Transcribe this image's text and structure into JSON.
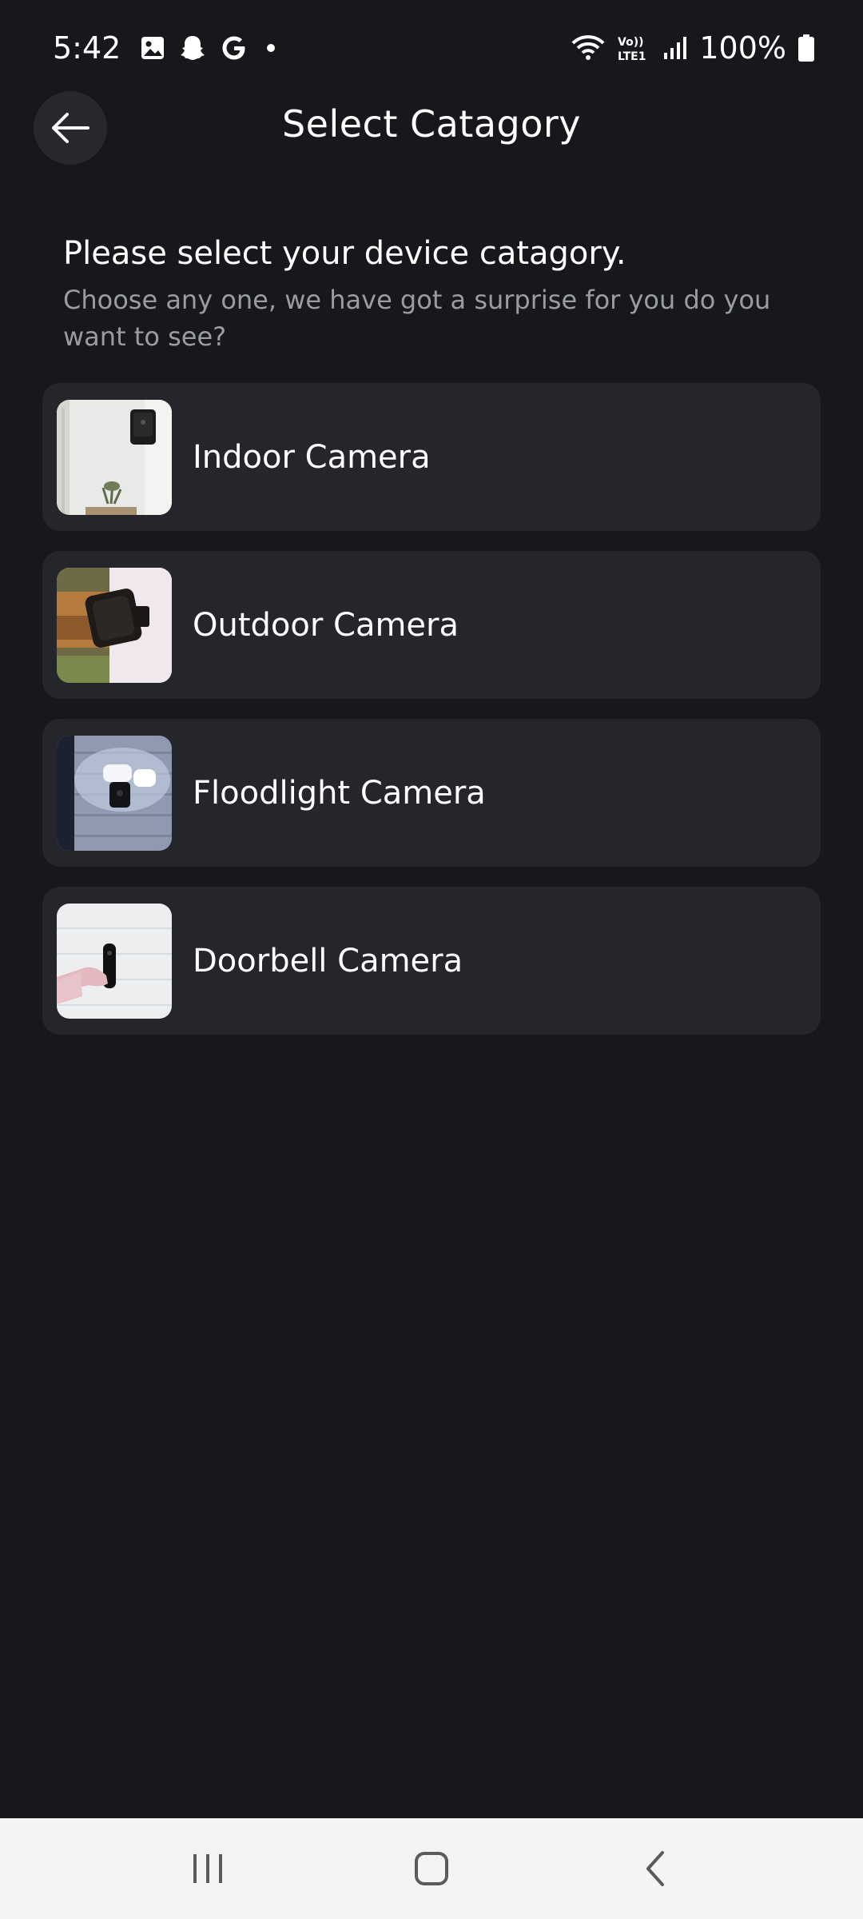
{
  "status_bar": {
    "time": "5:42",
    "battery": "100%",
    "icons_left": [
      "gallery-icon",
      "snapchat-icon",
      "google-icon",
      "dot-icon"
    ],
    "icons_right": [
      "wifi-icon",
      "volte-icon",
      "signal-icon",
      "battery-icon"
    ]
  },
  "header": {
    "title": "Select Catagory",
    "back_icon": "arrow-left-icon"
  },
  "intro": {
    "heading": "Please select your device catagory.",
    "subtext": "Choose any one, we have got a surprise for you do you want to see?"
  },
  "categories": [
    {
      "label": "Indoor Camera",
      "thumb": "indoor-camera-thumb"
    },
    {
      "label": "Outdoor Camera",
      "thumb": "outdoor-camera-thumb"
    },
    {
      "label": "Floodlight Camera",
      "thumb": "floodlight-camera-thumb"
    },
    {
      "label": "Doorbell Camera",
      "thumb": "doorbell-camera-thumb"
    }
  ],
  "nav_bar": {
    "items": [
      "recents-icon",
      "home-icon",
      "back-icon"
    ]
  },
  "colors": {
    "background": "#16181c",
    "card": "#24262b",
    "text_primary": "#ffffff",
    "text_secondary": "#9a9ca2",
    "nav_bar": "#f4f4f4"
  }
}
